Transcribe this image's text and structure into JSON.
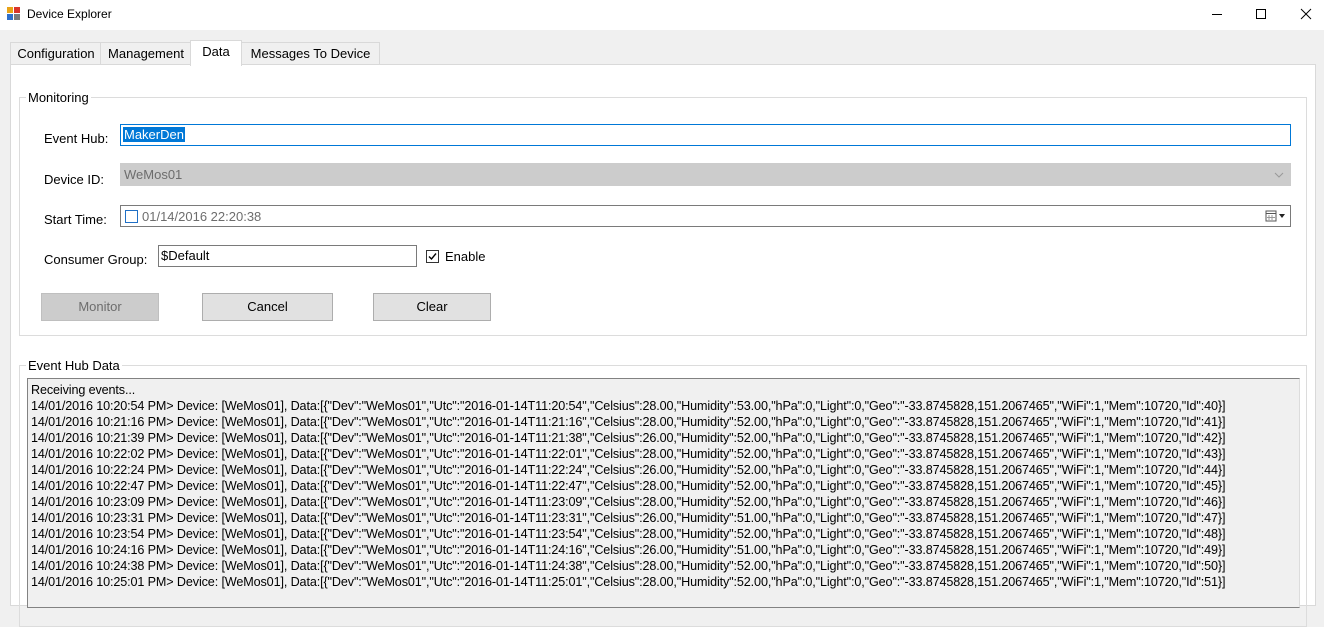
{
  "window": {
    "title": "Device Explorer"
  },
  "tabs": [
    {
      "label": "Configuration"
    },
    {
      "label": "Management"
    },
    {
      "label": "Data"
    },
    {
      "label": "Messages To Device"
    }
  ],
  "monitoring": {
    "group_title": "Monitoring",
    "event_hub_label": "Event Hub:",
    "event_hub_value": "MakerDen",
    "device_id_label": "Device ID:",
    "device_id_value": "WeMos01",
    "start_time_label": "Start Time:",
    "start_time_value": "01/14/2016 22:20:38",
    "consumer_group_label": "Consumer Group:",
    "consumer_group_value": "$Default",
    "enable_label": "Enable",
    "enable_checked": true,
    "monitor_button": "Monitor",
    "cancel_button": "Cancel",
    "clear_button": "Clear"
  },
  "event_hub_data": {
    "group_title": "Event Hub Data",
    "lines": [
      "Receiving events...",
      "14/01/2016 10:20:54 PM> Device: [WeMos01], Data:[{\"Dev\":\"WeMos01\",\"Utc\":\"2016-01-14T11:20:54\",\"Celsius\":28.00,\"Humidity\":53.00,\"hPa\":0,\"Light\":0,\"Geo\":\"-33.8745828,151.2067465\",\"WiFi\":1,\"Mem\":10720,\"Id\":40}]",
      "14/01/2016 10:21:16 PM> Device: [WeMos01], Data:[{\"Dev\":\"WeMos01\",\"Utc\":\"2016-01-14T11:21:16\",\"Celsius\":28.00,\"Humidity\":52.00,\"hPa\":0,\"Light\":0,\"Geo\":\"-33.8745828,151.2067465\",\"WiFi\":1,\"Mem\":10720,\"Id\":41}]",
      "14/01/2016 10:21:39 PM> Device: [WeMos01], Data:[{\"Dev\":\"WeMos01\",\"Utc\":\"2016-01-14T11:21:38\",\"Celsius\":26.00,\"Humidity\":52.00,\"hPa\":0,\"Light\":0,\"Geo\":\"-33.8745828,151.2067465\",\"WiFi\":1,\"Mem\":10720,\"Id\":42}]",
      "14/01/2016 10:22:02 PM> Device: [WeMos01], Data:[{\"Dev\":\"WeMos01\",\"Utc\":\"2016-01-14T11:22:01\",\"Celsius\":28.00,\"Humidity\":52.00,\"hPa\":0,\"Light\":0,\"Geo\":\"-33.8745828,151.2067465\",\"WiFi\":1,\"Mem\":10720,\"Id\":43}]",
      "14/01/2016 10:22:24 PM> Device: [WeMos01], Data:[{\"Dev\":\"WeMos01\",\"Utc\":\"2016-01-14T11:22:24\",\"Celsius\":26.00,\"Humidity\":52.00,\"hPa\":0,\"Light\":0,\"Geo\":\"-33.8745828,151.2067465\",\"WiFi\":1,\"Mem\":10720,\"Id\":44}]",
      "14/01/2016 10:22:47 PM> Device: [WeMos01], Data:[{\"Dev\":\"WeMos01\",\"Utc\":\"2016-01-14T11:22:47\",\"Celsius\":28.00,\"Humidity\":52.00,\"hPa\":0,\"Light\":0,\"Geo\":\"-33.8745828,151.2067465\",\"WiFi\":1,\"Mem\":10720,\"Id\":45}]",
      "14/01/2016 10:23:09 PM> Device: [WeMos01], Data:[{\"Dev\":\"WeMos01\",\"Utc\":\"2016-01-14T11:23:09\",\"Celsius\":28.00,\"Humidity\":52.00,\"hPa\":0,\"Light\":0,\"Geo\":\"-33.8745828,151.2067465\",\"WiFi\":1,\"Mem\":10720,\"Id\":46}]",
      "14/01/2016 10:23:31 PM> Device: [WeMos01], Data:[{\"Dev\":\"WeMos01\",\"Utc\":\"2016-01-14T11:23:31\",\"Celsius\":26.00,\"Humidity\":51.00,\"hPa\":0,\"Light\":0,\"Geo\":\"-33.8745828,151.2067465\",\"WiFi\":1,\"Mem\":10720,\"Id\":47}]",
      "14/01/2016 10:23:54 PM> Device: [WeMos01], Data:[{\"Dev\":\"WeMos01\",\"Utc\":\"2016-01-14T11:23:54\",\"Celsius\":28.00,\"Humidity\":52.00,\"hPa\":0,\"Light\":0,\"Geo\":\"-33.8745828,151.2067465\",\"WiFi\":1,\"Mem\":10720,\"Id\":48}]",
      "14/01/2016 10:24:16 PM> Device: [WeMos01], Data:[{\"Dev\":\"WeMos01\",\"Utc\":\"2016-01-14T11:24:16\",\"Celsius\":26.00,\"Humidity\":51.00,\"hPa\":0,\"Light\":0,\"Geo\":\"-33.8745828,151.2067465\",\"WiFi\":1,\"Mem\":10720,\"Id\":49}]",
      "14/01/2016 10:24:38 PM> Device: [WeMos01], Data:[{\"Dev\":\"WeMos01\",\"Utc\":\"2016-01-14T11:24:38\",\"Celsius\":28.00,\"Humidity\":52.00,\"hPa\":0,\"Light\":0,\"Geo\":\"-33.8745828,151.2067465\",\"WiFi\":1,\"Mem\":10720,\"Id\":50}]",
      "14/01/2016 10:25:01 PM> Device: [WeMos01], Data:[{\"Dev\":\"WeMos01\",\"Utc\":\"2016-01-14T11:25:01\",\"Celsius\":28.00,\"Humidity\":52.00,\"hPa\":0,\"Light\":0,\"Geo\":\"-33.8745828,151.2067465\",\"WiFi\":1,\"Mem\":10720,\"Id\":51}]"
    ]
  }
}
